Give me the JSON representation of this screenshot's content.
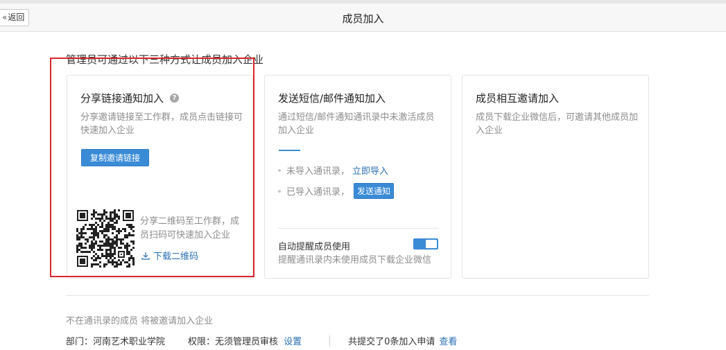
{
  "header": {
    "back_label": "返回",
    "title": "成员加入"
  },
  "intro": "管理员可通过以下三种方式让成员加入企业",
  "cards": {
    "share": {
      "title": "分享链接通知加入",
      "help_icon": "question-circle-icon",
      "desc": "分享邀请链接至工作群，成员点击链接可快速加入企业",
      "copy_button": "复制邀请链接",
      "qr_desc": "分享二维码至工作群，成员扫码可快速加入企业",
      "download_label": "下载二维码"
    },
    "sms": {
      "title": "发送短信/邮件通知加入",
      "desc": "通过短信/邮件通知通讯录中未激活成员加入企业",
      "row1_text": "未导入通讯录，",
      "row1_link": "立即导入",
      "row2_text": "已导入通讯录，",
      "row2_button": "发送通知",
      "auto_title": "自动提醒成员使用",
      "auto_desc": "提醒通讯录内未使用成员下载企业微信",
      "auto_enabled": true
    },
    "invite": {
      "title": "成员相互邀请加入",
      "desc": "成员下载企业微信后，可邀请其他成员加入企业"
    }
  },
  "footer": {
    "note": "不在通讯录的成员 将被邀请加入企业",
    "dept_label": "部门：",
    "dept_value": "河南艺术职业学院",
    "perm_label": "权限：",
    "perm_value": "无须管理员审核",
    "settings_link": "设置",
    "requests_text": "共提交了0条加入申请",
    "view_link": "查看"
  },
  "colors": {
    "accent": "#3a8bd6",
    "link": "#2a6fb3",
    "highlight_box": "#d9262a"
  }
}
